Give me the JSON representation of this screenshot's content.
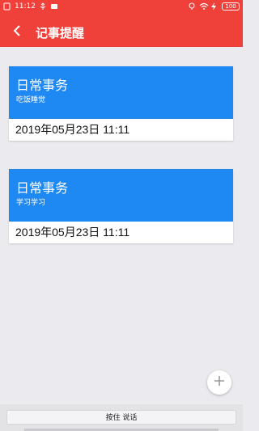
{
  "status_bar": {
    "time": "11:12",
    "battery": "100"
  },
  "app_bar": {
    "title": "记事提醒"
  },
  "notes": [
    {
      "title": "日常事务",
      "subtitle": "吃饭睡觉",
      "date": "2019年05月23日 11:11"
    },
    {
      "title": "日常事务",
      "subtitle": "学习学习",
      "date": "2019年05月23日 11:11"
    }
  ],
  "bottom": {
    "voice_button_label": "按住 说话"
  },
  "colors": {
    "primary": "#f0403a",
    "card_header": "#1e88f3",
    "background": "#ebebef"
  },
  "icons": {
    "back": "chevron-left-icon",
    "fab": "plus-icon"
  }
}
